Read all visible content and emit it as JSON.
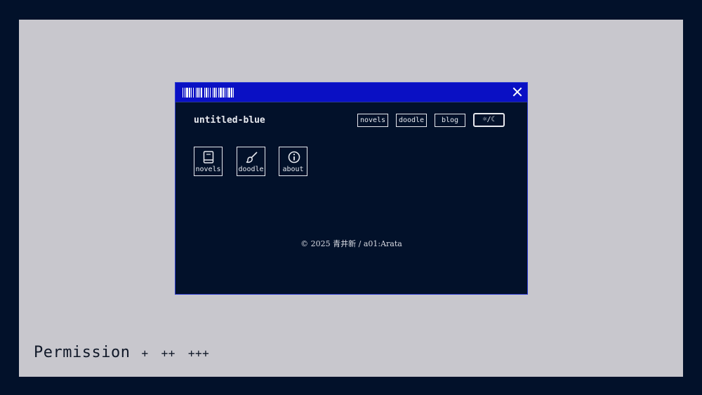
{
  "window": {
    "site_title": "untitled-blue",
    "nav": [
      {
        "label": "novels"
      },
      {
        "label": "doodle"
      },
      {
        "label": "blog"
      }
    ],
    "theme_toggle": {
      "label": "☼/☾"
    },
    "tiles": [
      {
        "label": "novels",
        "icon": "book-icon"
      },
      {
        "label": "doodle",
        "icon": "brush-icon"
      },
      {
        "label": "about",
        "icon": "info-icon"
      }
    ],
    "footer": "© 2025 青井新 / a01:Arata"
  },
  "caption": {
    "title": "Permission",
    "levels": [
      "+",
      "++",
      "+++"
    ]
  },
  "colors": {
    "background": "#02112a",
    "canvas": "#c8c7cd",
    "titlebar": "#0a10c4",
    "text": "#e6e8ee"
  }
}
